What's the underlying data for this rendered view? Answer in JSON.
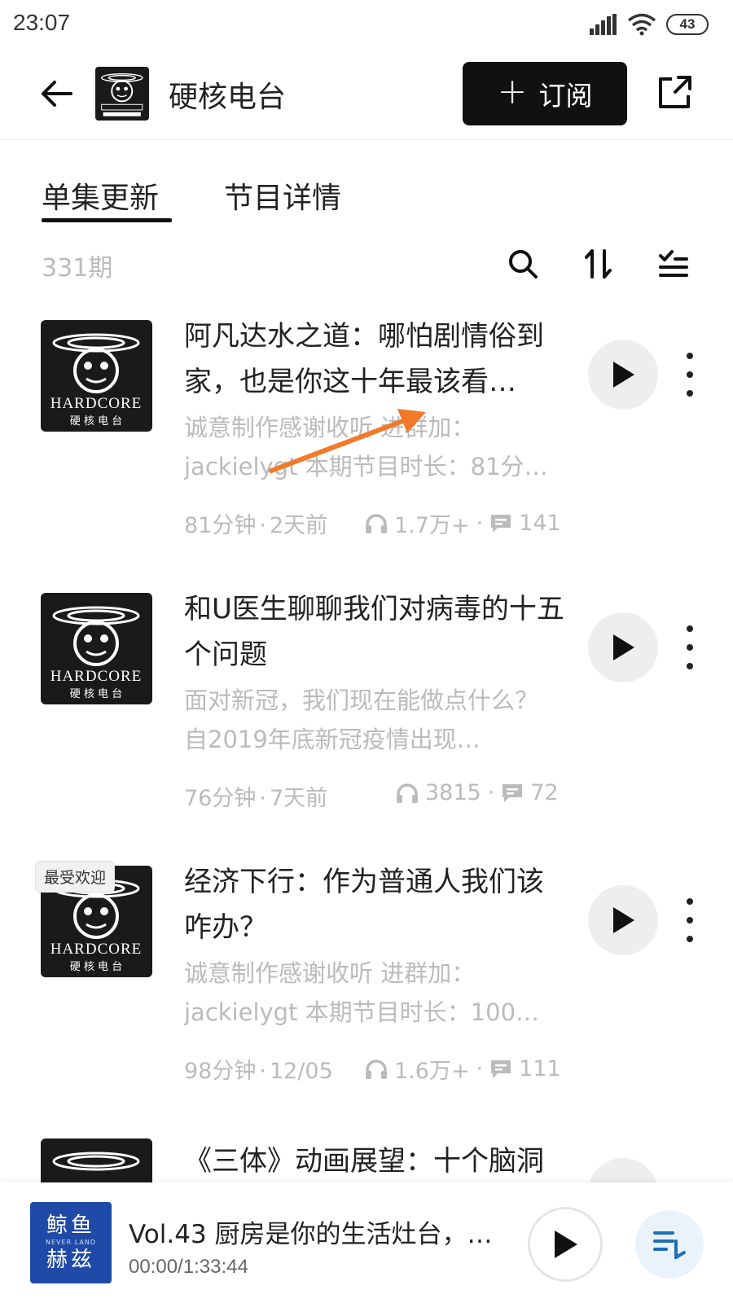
{
  "status_bar": {
    "time": "23:07",
    "battery": "43"
  },
  "header": {
    "podcast_title": "硬核电台",
    "subscribe_label": "订阅"
  },
  "tabs": [
    {
      "label": "单集更新"
    },
    {
      "label": "节目详情"
    }
  ],
  "toolbar": {
    "episode_count": "331期"
  },
  "cover_art_text": {
    "brand": "HARDCORE",
    "subtitle": "硬 核 电 台"
  },
  "episodes": [
    {
      "title": "阿凡达水之道：哪怕剧情俗到家，也是你这十年最该看…",
      "description": "诚意制作感谢收听 进群加：jackielygt 本期节目时长：81分…",
      "duration": "81分钟",
      "date": "2天前",
      "plays": "1.7万+",
      "comments": "141"
    },
    {
      "title": "和U医生聊聊我们对病毒的十五个问题",
      "description": "面对新冠，我们现在能做点什么？自2019年底新冠疫情出现…",
      "duration": "76分钟",
      "date": "7天前",
      "plays": "3815",
      "comments": "72"
    },
    {
      "badge": "最受欢迎",
      "title": "经济下行：作为普通人我们该咋办？",
      "description": "诚意制作感谢收听 进群加：jackielygt 本期节目时长：100…",
      "duration": "98分钟",
      "date": "12/05",
      "plays": "1.6万+",
      "comments": "111"
    },
    {
      "title": "《三体》动画展望：十个脑洞"
    }
  ],
  "mini_player": {
    "cover_text_1": "鲸鱼",
    "cover_text_2": "NEVER LAND",
    "cover_text_3": "赫兹",
    "title": "Vol.43 厨房是你的生活灶台，…",
    "time": "00:00/1:33:44"
  },
  "colors": {
    "accent": "#111111",
    "muted_text": "#bbbbbb",
    "annotation_arrow": "#f07a2a",
    "mini_cover_bg": "#1f4aa8"
  }
}
